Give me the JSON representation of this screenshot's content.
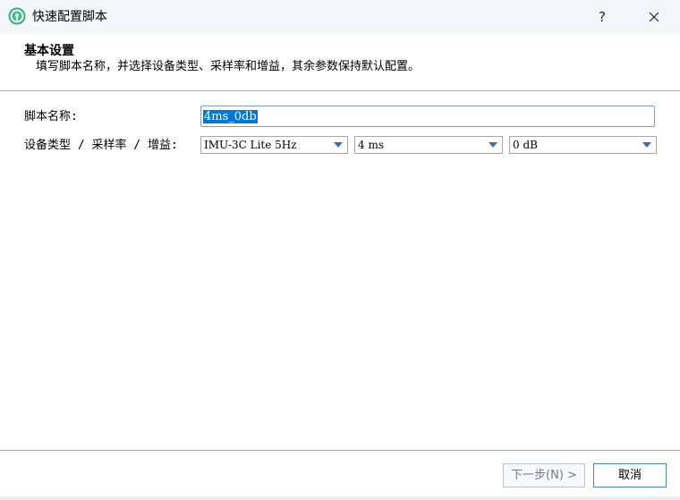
{
  "window": {
    "title": "快速配置脚本",
    "help_label": "?",
    "close_icon": "close-icon",
    "app_icon": "signal-tower-icon",
    "app_icon_color": "#2db37a"
  },
  "header": {
    "title": "基本设置",
    "subtitle": "填写脚本名称，并选择设备类型、采样率和增益，其余参数保持默认配置。"
  },
  "form": {
    "name_label": "脚本名称:",
    "name_value": "4ms_0db",
    "device_label": "设备类型 / 采样率 / 增益:",
    "device_type": "IMU-3C Lite 5Hz",
    "sample_rate": "4 ms",
    "gain": "0 dB"
  },
  "footer": {
    "next_label": "下一步(N) >",
    "cancel_label": "取消"
  },
  "colors": {
    "selection": "#0078d7",
    "focus_border": "#7a9cc6",
    "dropdown_arrow": "#3c6ab4"
  }
}
